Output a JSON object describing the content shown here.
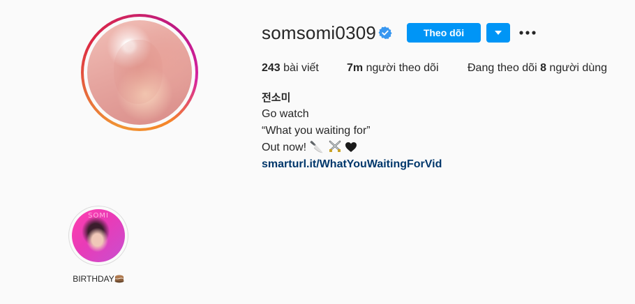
{
  "profile": {
    "username": "somsomi0309",
    "verified_icon": "verified-badge-icon",
    "avatar_alt": "profile-photo"
  },
  "actions": {
    "follow_label": "Theo dõi",
    "dropdown_icon": "triangle-down-icon",
    "more_icon": "more-options-icon"
  },
  "stats": {
    "posts_count": "243",
    "posts_label": " bài viết",
    "followers_count": "7m",
    "followers_label": " người theo dõi",
    "following_prefix": "Đang theo dõi ",
    "following_count": "8",
    "following_suffix": " người dùng"
  },
  "bio": {
    "name": "전소미",
    "line1": "Go watch",
    "line2": "“What you waiting for”",
    "line3": "Out now! 🔪",
    "line3_emojis": [
      "crossed-swords-icon",
      "black-heart-icon"
    ],
    "link": "smarturl.it/WhatYouWaitingForVid"
  },
  "highlights": [
    {
      "label": "BIRTHDAY",
      "emoji": "cake-icon",
      "cover_text": "SOMI"
    }
  ],
  "colors": {
    "accent": "#0095f6",
    "link": "#00376b",
    "background": "#fafafa",
    "text": "#262626"
  }
}
